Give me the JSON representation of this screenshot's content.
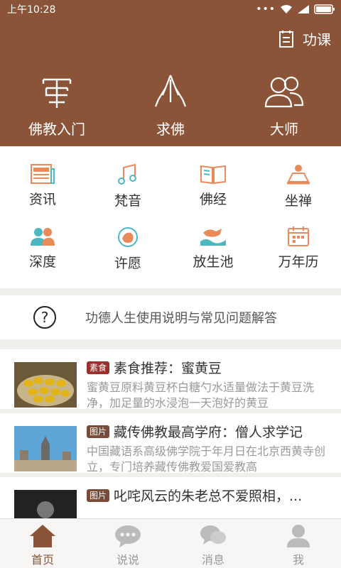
{
  "status": {
    "time": "上午10:28"
  },
  "header": {
    "gongke_label": "功课"
  },
  "hero": [
    {
      "label": "佛教入门",
      "icon": "swastika-icon"
    },
    {
      "label": "求佛",
      "icon": "praying-hands-icon"
    },
    {
      "label": "大师",
      "icon": "masters-icon"
    }
  ],
  "grid": [
    {
      "label": "资讯",
      "icon": "news-icon"
    },
    {
      "label": "梵音",
      "icon": "music-note-icon"
    },
    {
      "label": "佛经",
      "icon": "book-icon"
    },
    {
      "label": "坐禅",
      "icon": "meditation-icon"
    },
    {
      "label": "深度",
      "icon": "people-icon"
    },
    {
      "label": "许愿",
      "icon": "wish-icon"
    },
    {
      "label": "放生池",
      "icon": "fish-icon"
    },
    {
      "label": "万年历",
      "icon": "calendar-icon"
    }
  ],
  "help": {
    "label": "功德人生使用说明与常见问题解答"
  },
  "news": [
    {
      "tag": "素食",
      "title": "素食推荐：蜜黄豆",
      "desc": "蜜黄豆原料黄豆杯白糖勺水适量做法于黄豆洗净，加足量的水浸泡一天泡好的黄豆"
    },
    {
      "tag": "图片",
      "title": "藏传佛教最高学府：僧人求学记",
      "desc": "中国藏语系高级佛学院于年月日在北京西黄寺创立，专门培养藏传佛教爱国爱教高"
    },
    {
      "tag": "图片",
      "title": "叱咤风云的朱老总不爱照相，...",
      "desc": ""
    }
  ],
  "tabs": [
    {
      "label": "首页"
    },
    {
      "label": "说说"
    },
    {
      "label": "消息"
    },
    {
      "label": "我"
    }
  ],
  "colors": {
    "brand": "#8b5438",
    "accent_orange": "#e98a5a",
    "accent_teal": "#4cb7c0"
  }
}
